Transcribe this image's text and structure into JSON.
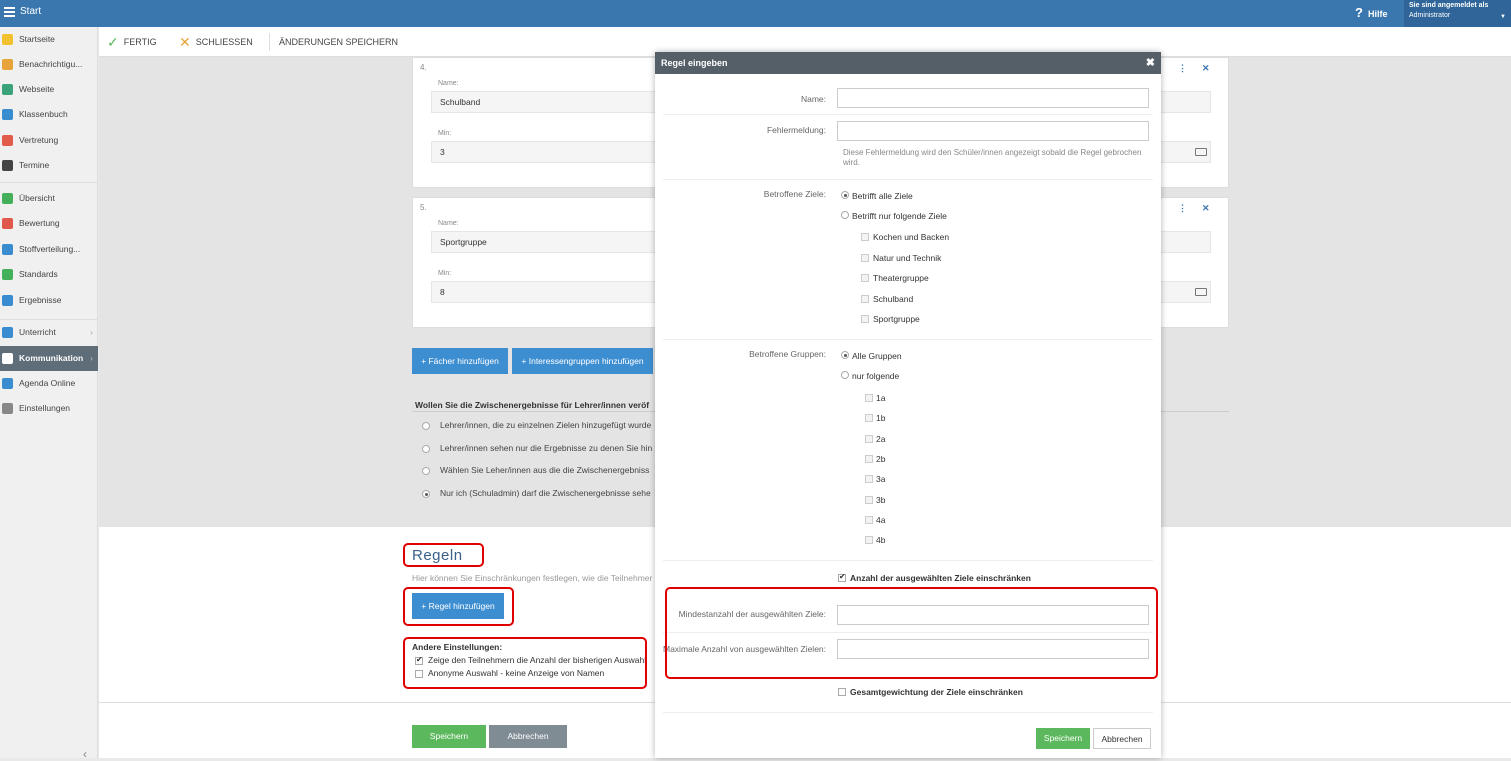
{
  "topbar": {
    "title": "Start",
    "help": "Hilfe",
    "user_line1": "Sie sind angemeldet als",
    "user_line2": "Administrator"
  },
  "sidebar": {
    "items": [
      {
        "label": "Startseite",
        "color": "#f2c12e"
      },
      {
        "label": "Benachrichtigu...",
        "color": "#e8a33a"
      },
      {
        "label": "Webseite",
        "color": "#3aa37a"
      },
      {
        "label": "Klassenbuch",
        "color": "#3a8cd0"
      },
      {
        "label": "Vertretung",
        "color": "#e25c4c"
      },
      {
        "label": "Termine",
        "color": "#444444"
      },
      {
        "label": "Übersicht",
        "color": "#44b05a"
      },
      {
        "label": "Bewertung",
        "color": "#e2574c"
      },
      {
        "label": "Stoffverteilung...",
        "color": "#3a8cd0"
      },
      {
        "label": "Standards",
        "color": "#44b05a"
      },
      {
        "label": "Ergebnisse",
        "color": "#3a8cd0"
      },
      {
        "label": "Unterricht",
        "color": "#3a8cd0"
      },
      {
        "label": "Kommunikation",
        "color": "#ffffff"
      },
      {
        "label": "Agenda Online",
        "color": "#3a8cd0"
      },
      {
        "label": "Einstellungen",
        "color": "#888888"
      }
    ]
  },
  "toolbar": {
    "fertig": "FERTIG",
    "schliessen": "SCHLIESSEN",
    "save_changes": "ÄNDERUNGEN SPEICHERN"
  },
  "cards": [
    {
      "num": "4.",
      "name_label": "Name:",
      "name": "Schulband",
      "min_label": "Min:",
      "min": "3"
    },
    {
      "num": "5.",
      "name_label": "Name:",
      "name": "Sportgruppe",
      "min_label": "Min:",
      "min": "8"
    }
  ],
  "buttons": {
    "add_subject": "+ Fächer hinzufügen",
    "add_interest": "+ Interessengruppen hinzufügen",
    "add_rule": "+ Regel hinzufügen",
    "save": "Speichern",
    "cancel": "Abbrechen"
  },
  "question": {
    "title": "Wollen Sie die Zwischenergebnisse für Lehrer/innen veröf",
    "options": [
      "Lehrer/innen, die zu einzelnen Zielen hinzugefügt wurde",
      "Lehrer/innen sehen nur die Ergebnisse zu denen Sie hin",
      "Wählen Sie Leher/innen aus die die Zwischenergebniss",
      "Nur ich (Schuladmin) darf die Zwischenergebnisse sehe"
    ]
  },
  "regeln": {
    "title": "Regeln",
    "subtitle": "Hier können Sie Einschränkungen festlegen, wie die Teilnehmer",
    "other_title": "Andere Einstellungen:",
    "opt1": "Zeige den Teilnehmern die Anzahl der bisherigen Auswahl",
    "opt2": "Anonyme Auswahl - keine Anzeige von Namen"
  },
  "modal": {
    "title": "Regel eingeben",
    "name_label": "Name:",
    "error_label": "Fehlermeldung:",
    "error_help": "Diese Fehlermeldung wird den Schüler/innen angezeigt sobald die Regel gebrochen wird.",
    "goals_label": "Betroffene Ziele:",
    "goals_all": "Betrifft alle Ziele",
    "goals_some": "Betrifft nur folgende Ziele",
    "goals": [
      "Kochen und Backen",
      "Natur und Technik",
      "Theatergruppe",
      "Schulband",
      "Sportgruppe"
    ],
    "groups_label": "Betroffene Gruppen:",
    "groups_all": "Alle Gruppen",
    "groups_some": "nur folgende",
    "groups": [
      "1a",
      "1b",
      "2a",
      "2b",
      "3a",
      "3b",
      "4a",
      "4b"
    ],
    "limit_count": "Anzahl der ausgewählten Ziele einschränken",
    "min_label": "Mindestanzahl der ausgewählten Ziele:",
    "max_label": "Maximale Anzahl von ausgewählten Zielen:",
    "limit_weight": "Gesamtgewichtung der Ziele einschränken",
    "save": "Speichern",
    "cancel": "Abbrechen"
  }
}
